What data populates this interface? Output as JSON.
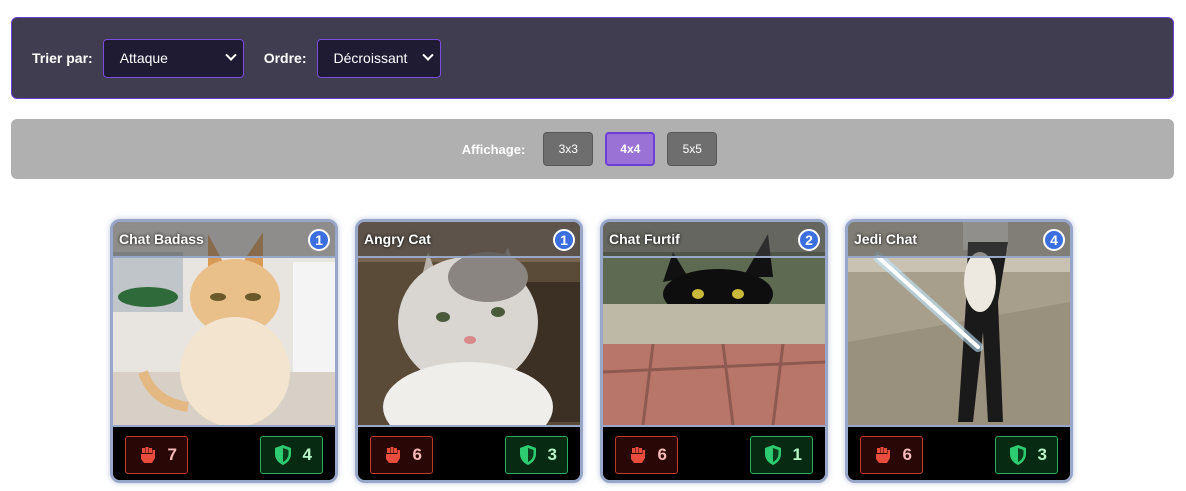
{
  "sort": {
    "label": "Trier par:",
    "value": "Attaque",
    "order_label": "Ordre:",
    "order_value": "Décroissant"
  },
  "display": {
    "label": "Affichage:",
    "options": [
      "3x3",
      "4x4",
      "5x5"
    ],
    "selected": "4x4"
  },
  "colors": {
    "accent": "#6b3fd6",
    "level_badge": "#3b6fe0",
    "attack": "#c0392b",
    "defense": "#27ae60",
    "card_border": "#98a7c8"
  },
  "cards": [
    {
      "name": "Chat Badass",
      "level": "1",
      "attack": "7",
      "defense": "4"
    },
    {
      "name": "Angry Cat",
      "level": "1",
      "attack": "6",
      "defense": "3"
    },
    {
      "name": "Chat Furtif",
      "level": "2",
      "attack": "6",
      "defense": "1"
    },
    {
      "name": "Jedi Chat",
      "level": "4",
      "attack": "6",
      "defense": "3"
    }
  ]
}
